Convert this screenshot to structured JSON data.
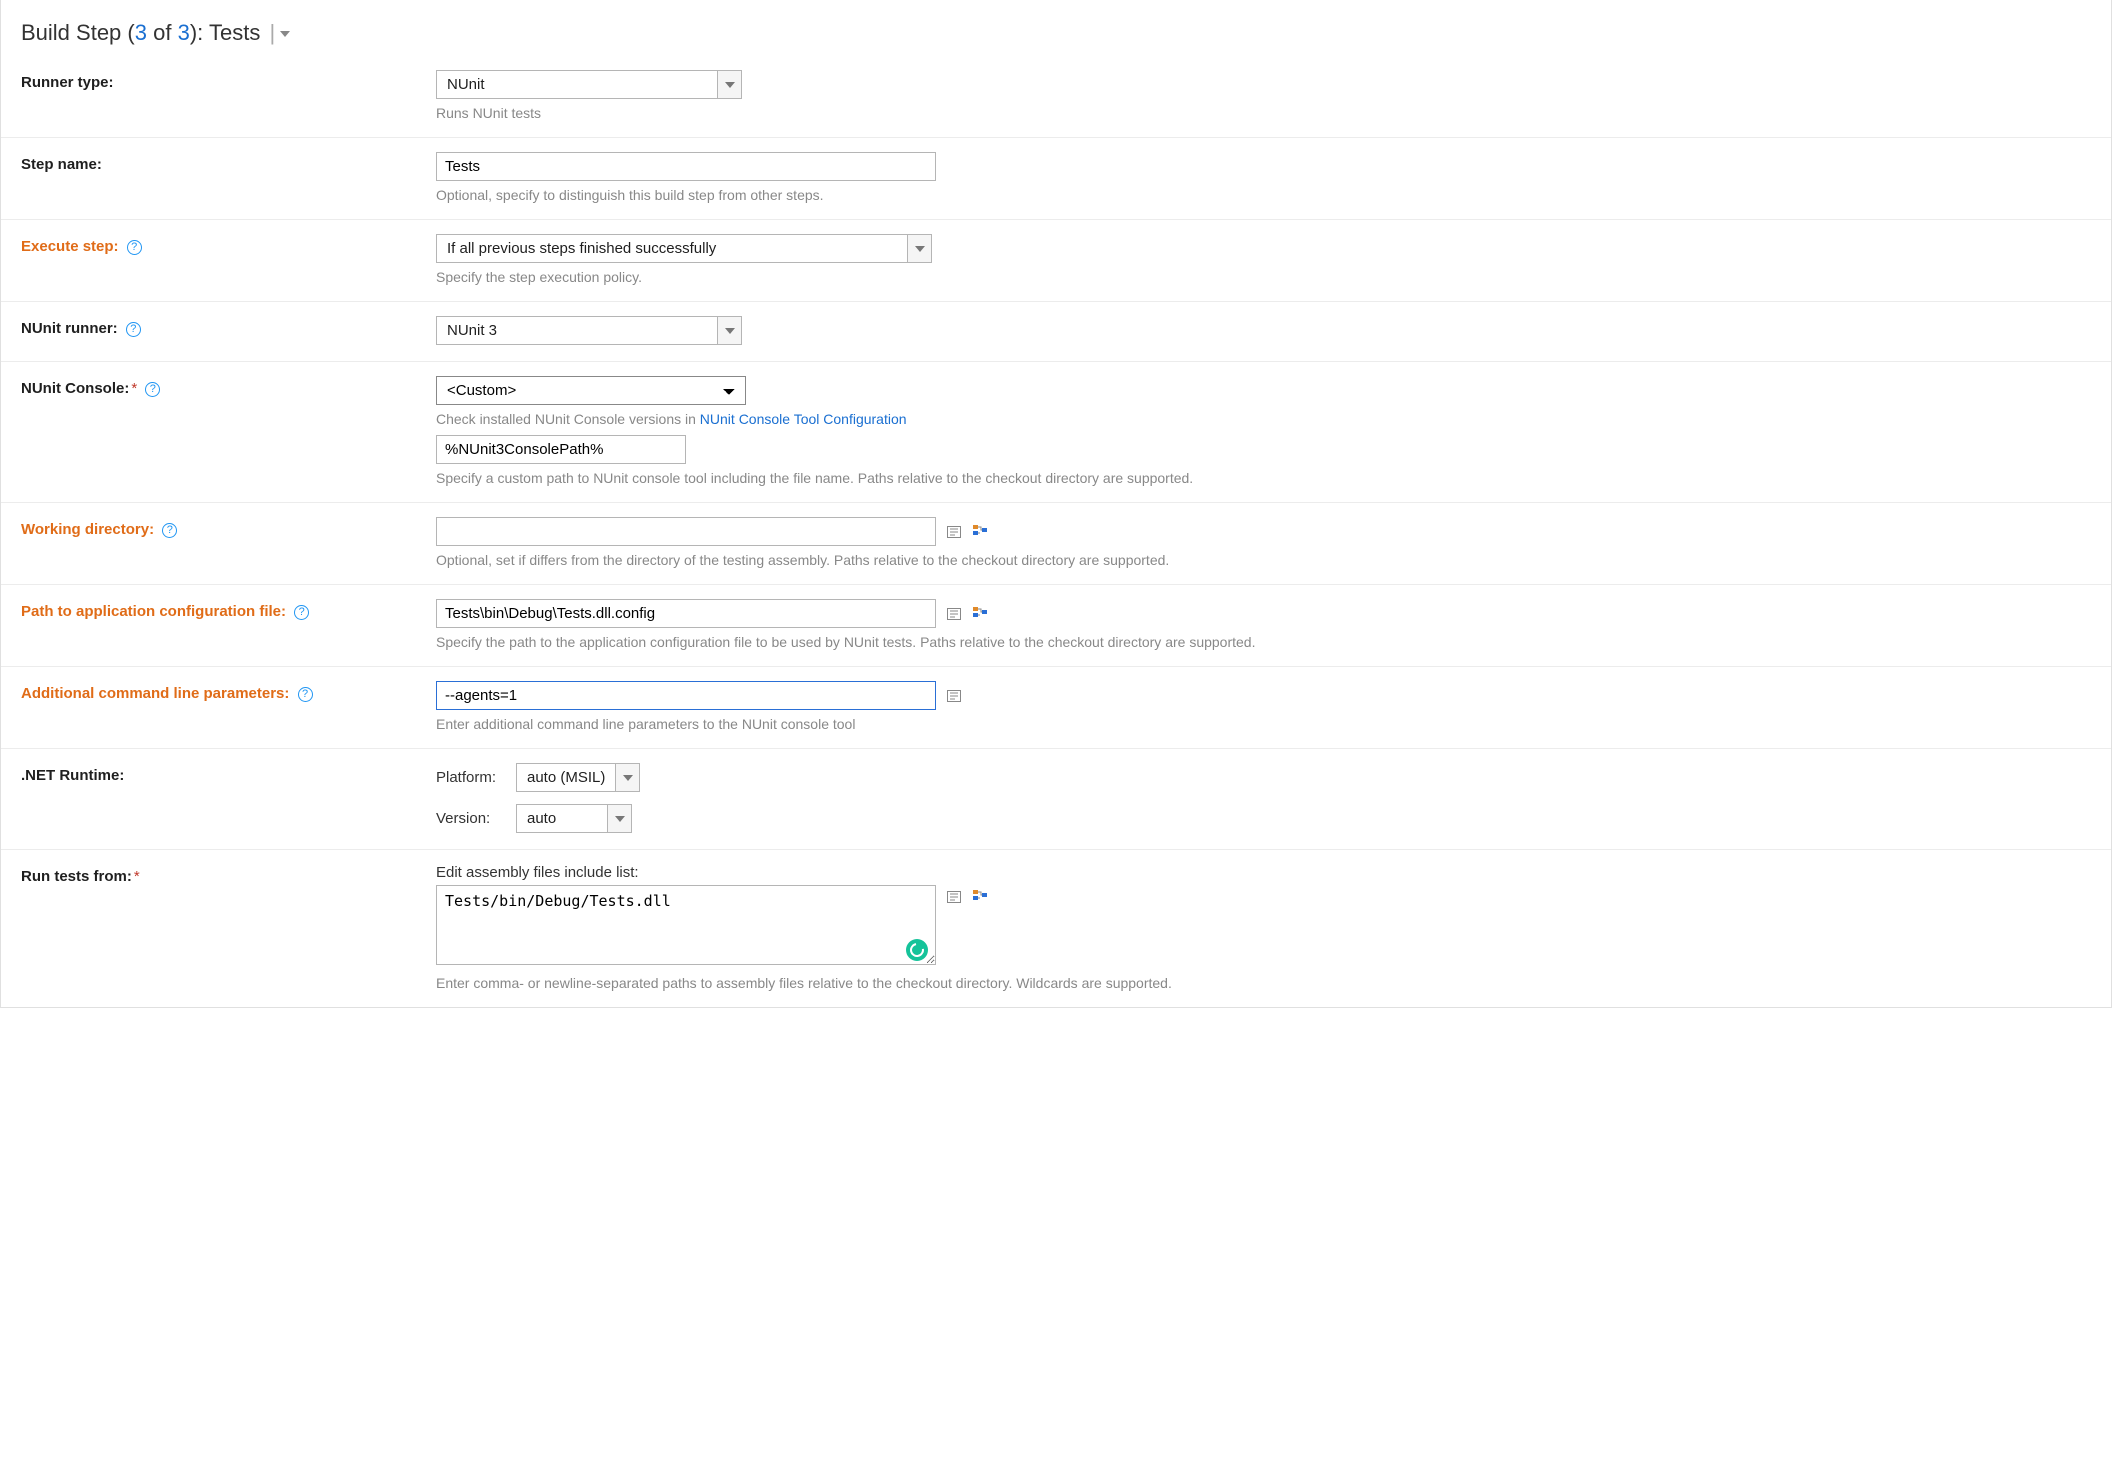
{
  "header": {
    "prefix": "Build Step (",
    "current": "3",
    "of": " of ",
    "total": "3",
    "suffix": "): ",
    "name": "Tests"
  },
  "runnerType": {
    "label": "Runner type:",
    "value": "NUnit",
    "hint": "Runs NUnit tests"
  },
  "stepName": {
    "label": "Step name:",
    "value": "Tests",
    "hint": "Optional, specify to distinguish this build step from other steps."
  },
  "executeStep": {
    "label": "Execute step:",
    "value": "If all previous steps finished successfully",
    "hint": "Specify the step execution policy."
  },
  "nunitRunner": {
    "label": "NUnit runner:",
    "value": "NUnit 3"
  },
  "nunitConsole": {
    "label": "NUnit Console:",
    "value": "<Custom>",
    "hintPrefix": "Check installed NUnit Console versions in ",
    "hintLink": "NUnit Console Tool Configuration",
    "customPath": "%NUnit3ConsolePath%",
    "customHint": "Specify a custom path to NUnit console tool including the file name. Paths relative to the checkout directory are supported."
  },
  "workingDir": {
    "label": "Working directory:",
    "value": "",
    "hint": "Optional, set if differs from the directory of the testing assembly. Paths relative to the checkout directory are supported."
  },
  "appConfig": {
    "label": "Path to application configuration file:",
    "value": "Tests\\bin\\Debug\\Tests.dll.config",
    "hint": "Specify the path to the application configuration file to be used by NUnit tests. Paths relative to the checkout directory are supported."
  },
  "cmdParams": {
    "label": "Additional command line parameters:",
    "value": "--agents=1",
    "hint": "Enter additional command line parameters to the NUnit console tool"
  },
  "dotnetRuntime": {
    "label": ".NET Runtime:",
    "platformLabel": "Platform:",
    "platformValue": "auto (MSIL)",
    "versionLabel": "Version:",
    "versionValue": "auto"
  },
  "runTests": {
    "label": "Run tests from:",
    "subLabel": "Edit assembly files include list:",
    "value": "Tests/bin/Debug/Tests.dll",
    "hint": "Enter comma- or newline-separated paths to assembly files relative to the checkout directory. Wildcards are supported."
  }
}
